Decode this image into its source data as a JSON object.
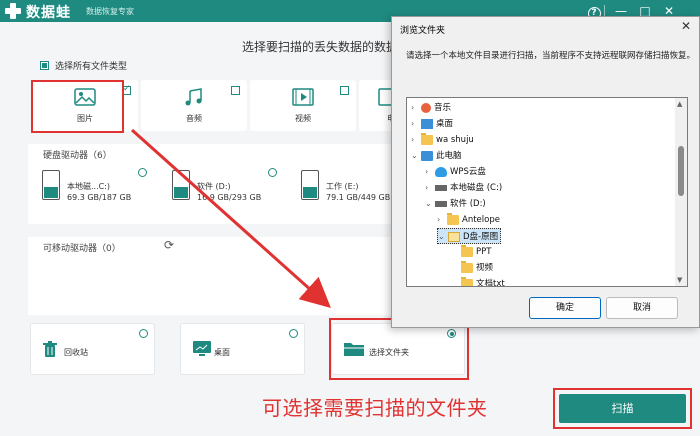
{
  "app": {
    "name": "数据蛙",
    "subtitle": "数据恢复专家"
  },
  "window_controls": {
    "help": "?",
    "minimize": "—",
    "maximize": "□",
    "close": "✕"
  },
  "main": {
    "title": "选择要扫描的丢失数据的数据类",
    "select_all_label": "选择所有文件类型",
    "file_types": [
      {
        "label": "图片",
        "icon": "image-icon",
        "checked": true
      },
      {
        "label": "音频",
        "icon": "audio-icon",
        "checked": false
      },
      {
        "label": "视频",
        "icon": "video-icon",
        "checked": false
      },
      {
        "label": "电",
        "icon": "document-icon",
        "checked": false
      }
    ],
    "hard_drives": {
      "title": "硬盘驱动器（6）",
      "items": [
        {
          "name": "本地磁...C:)",
          "size": "69.3 GB/187 GB"
        },
        {
          "name": "软件 (D:)",
          "size": "16.9 GB/293 GB"
        },
        {
          "name": "工作 (E:)",
          "size": "79.1 GB/449 GB"
        }
      ]
    },
    "removable": {
      "title": "可移动驱动器（0）"
    },
    "locations": [
      {
        "label": "回收站",
        "icon": "trash-icon"
      },
      {
        "label": "桌面",
        "icon": "desktop-icon"
      },
      {
        "label": "选择文件夹",
        "icon": "folder-icon",
        "selected": true
      }
    ],
    "annotation": "可选择需要扫描的文件夹",
    "scan_button": "扫描"
  },
  "dialog": {
    "title": "浏览文件夹",
    "description": "请选择一个本地文件目录进行扫描，当前程序不支持远程联网存储扫描恢复。",
    "tree": [
      {
        "label": "音乐",
        "icon": "music",
        "expand": "›"
      },
      {
        "label": "桌面",
        "icon": "desk",
        "expand": "›"
      },
      {
        "label": "wa shuju",
        "icon": "folder",
        "expand": "›"
      },
      {
        "label": "此电脑",
        "icon": "pc",
        "expand": "⌄"
      },
      {
        "label": "WPS云盘",
        "icon": "cloud",
        "expand": "›"
      },
      {
        "label": "本地磁盘 (C:)",
        "icon": "disk",
        "expand": "›"
      },
      {
        "label": "软件 (D:)",
        "icon": "disk",
        "expand": "⌄"
      },
      {
        "label": "Antelope",
        "icon": "folder",
        "expand": "›"
      },
      {
        "label": "D盘-原图",
        "icon": "openf",
        "expand": "⌄",
        "selected": true
      },
      {
        "label": "PPT",
        "icon": "folder",
        "expand": ""
      },
      {
        "label": "视频",
        "icon": "folder",
        "expand": ""
      },
      {
        "label": "文档txt",
        "icon": "folder",
        "expand": ""
      }
    ],
    "ok_button": "确定",
    "cancel_button": "取消",
    "close": "✕"
  },
  "colors": {
    "accent": "#1f8a80",
    "annotation_red": "#e13232"
  }
}
